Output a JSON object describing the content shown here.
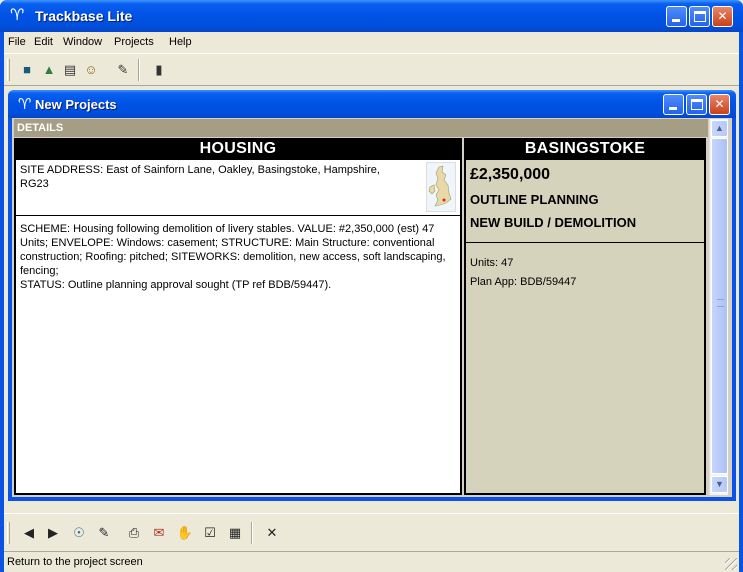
{
  "window": {
    "title": "Trackbase Lite"
  },
  "menu": [
    "File",
    "Edit",
    "Window",
    "Projects",
    "Help"
  ],
  "toolbar_top": {
    "icons": [
      "open-projects-icon",
      "new-projects-icon",
      "calendar-icon",
      "search-people-icon",
      "pen-icon",
      "exit-door-icon"
    ]
  },
  "child": {
    "title": "New Projects",
    "section_label": "DETAILS",
    "left": {
      "heading": "HOUSING",
      "address": "SITE ADDRESS: East of Sainforn Lane, Oakley, Basingstoke, Hampshire, RG23",
      "scheme": "SCHEME: Housing following demolition of livery stables.  VALUE: #2,350,000 (est) 47 Units;  ENVELOPE: Windows: casement; STRUCTURE: Main Structure: conventional construction; Roofing: pitched; SITEWORKS: demolition, new access, soft landscaping, fencing;\nSTATUS: Outline planning approval sought (TP ref BDB/59447)."
    },
    "right": {
      "heading": "BASINGSTOKE",
      "value": "£2,350,000",
      "stage": "OUTLINE PLANNING",
      "type": "NEW BUILD / DEMOLITION",
      "units": "Units: 47",
      "plan_app": "Plan App: BDB/59447"
    }
  },
  "toolbar_bottom": {
    "icons": [
      "prev-arrow-icon",
      "next-arrow-icon",
      "find-icon",
      "edit-pen-icon",
      "print-icon",
      "fax-icon",
      "contacts-hands-icon",
      "notes-icon",
      "grid-icon",
      "close-x-icon"
    ]
  },
  "status": {
    "text": "Return to the project screen"
  },
  "colors": {
    "titlebar": "#0053e6",
    "details_header": "#a59d84",
    "right_panel": "#d6d3bd"
  }
}
